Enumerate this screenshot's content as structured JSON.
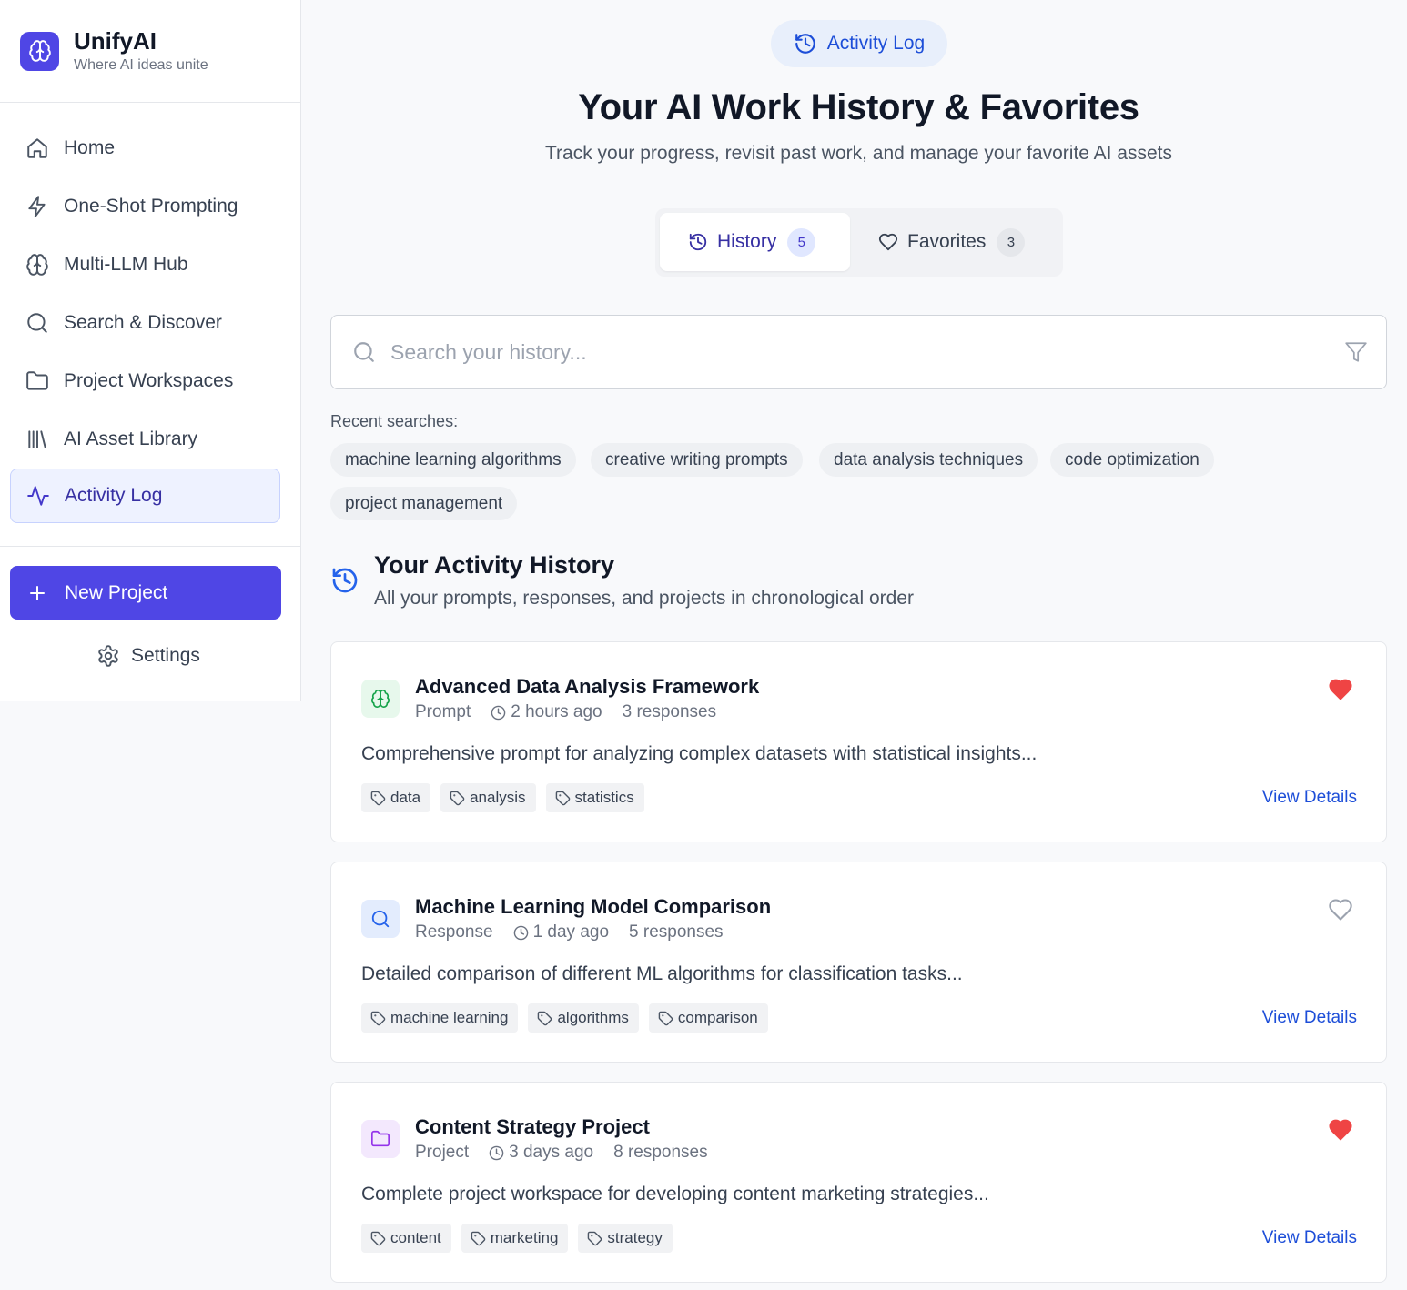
{
  "brand": {
    "name": "UnifyAI",
    "tagline": "Where AI ideas unite"
  },
  "nav": [
    {
      "label": "Home",
      "icon": "home-icon"
    },
    {
      "label": "One-Shot Prompting",
      "icon": "bolt-icon"
    },
    {
      "label": "Multi-LLM Hub",
      "icon": "brain-icon"
    },
    {
      "label": "Search & Discover",
      "icon": "search-icon"
    },
    {
      "label": "Project Workspaces",
      "icon": "folder-icon"
    },
    {
      "label": "AI Asset Library",
      "icon": "library-icon"
    },
    {
      "label": "Activity Log",
      "icon": "activity-icon",
      "active": true
    }
  ],
  "actions": {
    "new_project": "New Project",
    "settings": "Settings"
  },
  "header": {
    "pill": "Activity Log",
    "title": "Your AI Work History & Favorites",
    "subtitle": "Track your progress, revisit past work, and manage your favorite AI assets"
  },
  "tabs": [
    {
      "label": "History",
      "count": "5",
      "active": true
    },
    {
      "label": "Favorites",
      "count": "3",
      "active": false
    }
  ],
  "search": {
    "placeholder": "Search your history...",
    "value": "",
    "recent_label": "Recent searches:",
    "recent": [
      "machine learning algorithms",
      "creative writing prompts",
      "data analysis techniques",
      "code optimization",
      "project management"
    ]
  },
  "activity": {
    "title": "Your Activity History",
    "subtitle": "All your prompts, responses, and projects in chronological order"
  },
  "items": [
    {
      "title": "Advanced Data Analysis Framework",
      "type": "Prompt",
      "time": "2 hours ago",
      "responses": "3 responses",
      "description": "Comprehensive prompt for analyzing complex datasets with statistical insights...",
      "tags": [
        "data",
        "analysis",
        "statistics"
      ],
      "favorited": true,
      "icon": "brain-icon",
      "details": "View Details"
    },
    {
      "title": "Machine Learning Model Comparison",
      "type": "Response",
      "time": "1 day ago",
      "responses": "5 responses",
      "description": "Detailed comparison of different ML algorithms for classification tasks...",
      "tags": [
        "machine learning",
        "algorithms",
        "comparison"
      ],
      "favorited": false,
      "icon": "search-icon",
      "details": "View Details"
    },
    {
      "title": "Content Strategy Project",
      "type": "Project",
      "time": "3 days ago",
      "responses": "8 responses",
      "description": "Complete project workspace for developing content marketing strategies...",
      "tags": [
        "content",
        "marketing",
        "strategy"
      ],
      "favorited": true,
      "icon": "folder-icon",
      "details": "View Details"
    }
  ],
  "colors": {
    "accent": "#4f46e5",
    "link": "#1d4ed8",
    "heart": "#ef4444"
  }
}
